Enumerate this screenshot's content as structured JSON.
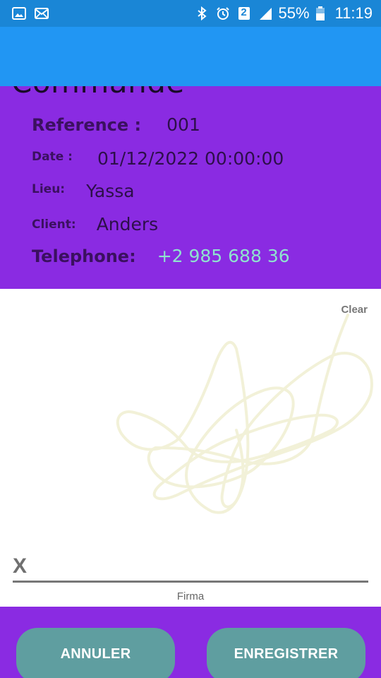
{
  "status_bar": {
    "left_icons": [
      "image-icon",
      "mail-icon"
    ],
    "right_icons": [
      "bluetooth-icon",
      "alarm-icon",
      "sim-2-icon",
      "signal-icon",
      "battery-icon"
    ],
    "sim_label": "2",
    "battery": "55%",
    "time": "11:19"
  },
  "colors": {
    "status_bar": "#1a86d6",
    "app_bar": "#2196f3",
    "panel": "#8a2be2",
    "button": "#5f9ea0",
    "phone_value": "#8fe3cf",
    "signature_stroke": "#f2f1d8"
  },
  "order": {
    "title": "Commande",
    "reference_label": "Reference :",
    "reference_value": "001",
    "date_label": "Date :",
    "date_value": "01/12/2022 00:00:00",
    "place_label": "Lieu:",
    "place_value": "Yassa",
    "client_label": "Client:",
    "client_value": "Anders",
    "phone_label": "Telephone:",
    "phone_value": "+2 985 688 36"
  },
  "signature": {
    "clear_label": "Clear",
    "x_mark": "X",
    "caption": "Firma"
  },
  "actions": {
    "cancel_label": "ANNULER",
    "save_label": "ENREGISTRER"
  }
}
